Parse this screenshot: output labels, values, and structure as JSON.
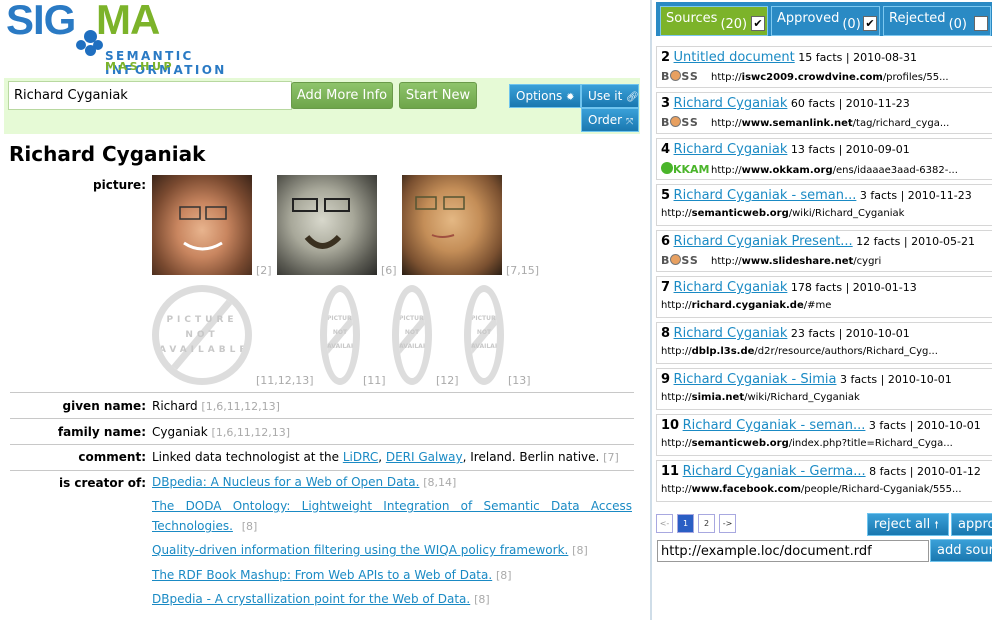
{
  "logo": {
    "part1": "SIG",
    "part2": "MA",
    "tagline1": "SEMANTIC INFORMATION",
    "tagline2": "MASHUP"
  },
  "search": {
    "value": "Richard Cyganiak",
    "add_more_info_label": "Add More Info",
    "start_new_label": "Start New"
  },
  "toolbar": {
    "options_label": "Options",
    "use_it_label": "Use it",
    "order_label": "Order"
  },
  "entity": {
    "title": "Richard Cyganiak",
    "picture": {
      "label": "picture:",
      "photos": [
        {
          "ref": "[2]"
        },
        {
          "ref": "[6]"
        },
        {
          "ref": "[7,15]"
        }
      ],
      "unavailable": [
        {
          "text": [
            "PICTURE",
            "NOT",
            "AVAILABLE"
          ],
          "ref": "[11,12,13]"
        },
        {
          "text": [
            "PICTURE",
            "NOT",
            "AVAILABLE"
          ],
          "ref": "[11]"
        },
        {
          "text": [
            "PICTURE",
            "NOT",
            "AVAILABLE"
          ],
          "ref": "[12]"
        },
        {
          "text": [
            "PICTURE",
            "NOT",
            "AVAILABLE"
          ],
          "ref": "[13]"
        }
      ]
    },
    "given_name": {
      "label": "given name:",
      "value": "Richard",
      "ref": "[1,6,11,12,13]"
    },
    "family_name": {
      "label": "family name:",
      "value": "Cyganiak",
      "ref": "[1,6,11,12,13]"
    },
    "comment": {
      "label": "comment:",
      "prefix": "Linked data technologist at the ",
      "link1": "LiDRC",
      "sep": ", ",
      "link2": "DERI Galway",
      "suffix": ", Ireland. Berlin native. ",
      "ref": "[7]"
    },
    "is_creator_of": {
      "label": "is creator of:",
      "items": [
        {
          "title": "DBpedia: A Nucleus for a Web of Open Data.",
          "ref": "[8,14]"
        },
        {
          "title": "The DODA Ontology: Lightweight Integration of Semantic Data Access Technologies.",
          "ref": "[8]"
        },
        {
          "title": "Quality-driven information filtering using the WIQA policy framework.",
          "ref": "[8]"
        },
        {
          "title": "The RDF Book Mashup: From Web APIs to a Web of Data.",
          "ref": "[8]"
        },
        {
          "title": "DBpedia - A crystallization point for the Web of Data.",
          "ref": "[8]"
        }
      ]
    }
  },
  "tabs": [
    {
      "label": "Sources",
      "count": "(20)",
      "checked": "✔",
      "active": true
    },
    {
      "label": "Approved",
      "count": "(0)",
      "checked": "✔",
      "active": false
    },
    {
      "label": "Rejected",
      "count": "(0)",
      "checked": "",
      "active": false
    }
  ],
  "sources": [
    {
      "num": "2",
      "title": "Untitled document",
      "meta": " 15 facts | 2010-08-31",
      "badge": "boss",
      "url_pre": "http://",
      "url_host": "iswc2009.crowdvine.com",
      "url_rest": "/profiles/55..."
    },
    {
      "num": "3",
      "title": "Richard Cyganiak",
      "meta": " 60 facts | 2010-11-23",
      "badge": "boss",
      "url_pre": "http://",
      "url_host": "www.semanlink.net",
      "url_rest": "/tag/richard_cyga..."
    },
    {
      "num": "4",
      "title": "Richard Cyganiak",
      "meta": " 13 facts | 2010-09-01",
      "badge": "okkam",
      "url_pre": "http://",
      "url_host": "www.okkam.org",
      "url_rest": "/ens/idaaae3aad-6382-..."
    },
    {
      "num": "5",
      "title": "Richard Cyganiak - seman...",
      "meta": " 3 facts | 2010-11-23",
      "badge": "",
      "url_pre": "http://",
      "url_host": "semanticweb.org",
      "url_rest": "/wiki/Richard_Cyganiak"
    },
    {
      "num": "6",
      "title": "Richard Cyganiak Present...",
      "meta": " 12 facts | 2010-05-21",
      "badge": "boss",
      "url_pre": "http://",
      "url_host": "www.slideshare.net",
      "url_rest": "/cygri"
    },
    {
      "num": "7",
      "title": "Richard Cyganiak",
      "meta": " 178 facts | 2010-01-13",
      "badge": "",
      "url_pre": "http://",
      "url_host": "richard.cyganiak.de",
      "url_rest": "/#me"
    },
    {
      "num": "8",
      "title": "Richard Cyganiak",
      "meta": " 23 facts | 2010-10-01",
      "badge": "",
      "url_pre": "http://",
      "url_host": "dblp.l3s.de",
      "url_rest": "/d2r/resource/authors/Richard_Cyg..."
    },
    {
      "num": "9",
      "title": "Richard Cyganiak - Simia",
      "meta": " 3 facts | 2010-10-01",
      "badge": "",
      "url_pre": "http://",
      "url_host": "simia.net",
      "url_rest": "/wiki/Richard_Cyganiak"
    },
    {
      "num": "10",
      "title": "Richard Cyganiak - seman...",
      "meta": " 3 facts | 2010-10-01",
      "badge": "",
      "url_pre": "http://",
      "url_host": "semanticweb.org",
      "url_rest": "/index.php?title=Richard_Cyga..."
    },
    {
      "num": "11",
      "title": "Richard Cyganiak - Germa...",
      "meta": " 8 facts | 2010-01-12",
      "badge": "",
      "url_pre": "http://",
      "url_host": "www.facebook.com",
      "url_rest": "/people/Richard-Cyganiak/555..."
    }
  ],
  "badges": {
    "boss": "B",
    "boss_rest": "SS",
    "okkam": "KKAM"
  },
  "pagination": {
    "prev": "<-",
    "pages": [
      "1",
      "2"
    ],
    "current": "1",
    "next": "->"
  },
  "actions": {
    "reject_all_label": "reject all",
    "approve_all_label": "approve all",
    "add_source_label": "add source"
  },
  "add_source": {
    "value": "http://example.loc/document.rdf"
  },
  "colors": {
    "accent_blue": "#2a8ac4",
    "accent_green": "#7cb32a",
    "link": "#1a8ac4",
    "search_bg": "#e6fad6"
  }
}
